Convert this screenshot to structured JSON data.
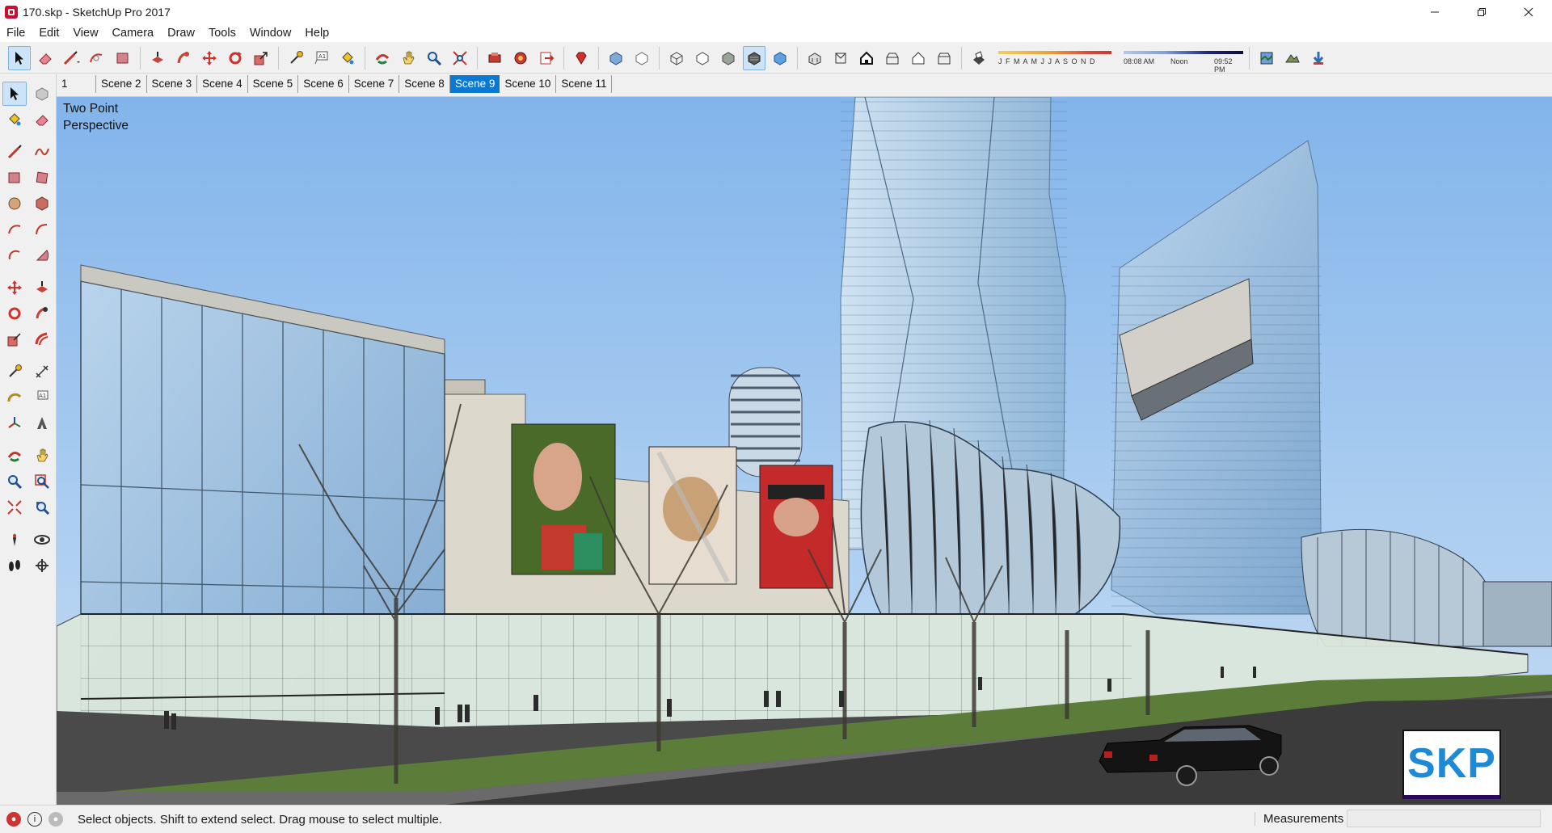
{
  "window": {
    "title": "170.skp - SketchUp Pro 2017"
  },
  "menu": [
    "File",
    "Edit",
    "View",
    "Camera",
    "Draw",
    "Tools",
    "Window",
    "Help"
  ],
  "shadow_settings": {
    "months": "J F M A M J J A S O N D",
    "time_start": "08:08 AM",
    "time_mid": "Noon",
    "time_end": "09:52 PM"
  },
  "scenes": {
    "tabs": [
      "1",
      "Scene 2",
      "Scene 3",
      "Scene 4",
      "Scene 5",
      "Scene 6",
      "Scene 7",
      "Scene 8",
      "Scene 9",
      "Scene 10",
      "Scene 11"
    ],
    "active": "Scene 9"
  },
  "viewport": {
    "camera_label_line1": "Two Point",
    "camera_label_line2": "Perspective",
    "badge": "SKP"
  },
  "status": {
    "message": "Select objects. Shift to extend select. Drag mouse to select multiple.",
    "measurements_label": "Measurements",
    "measurements_value": ""
  },
  "colors": {
    "accent": "#0a79d4",
    "sky": "#82b4eb",
    "badge": "#1e8ad6"
  }
}
